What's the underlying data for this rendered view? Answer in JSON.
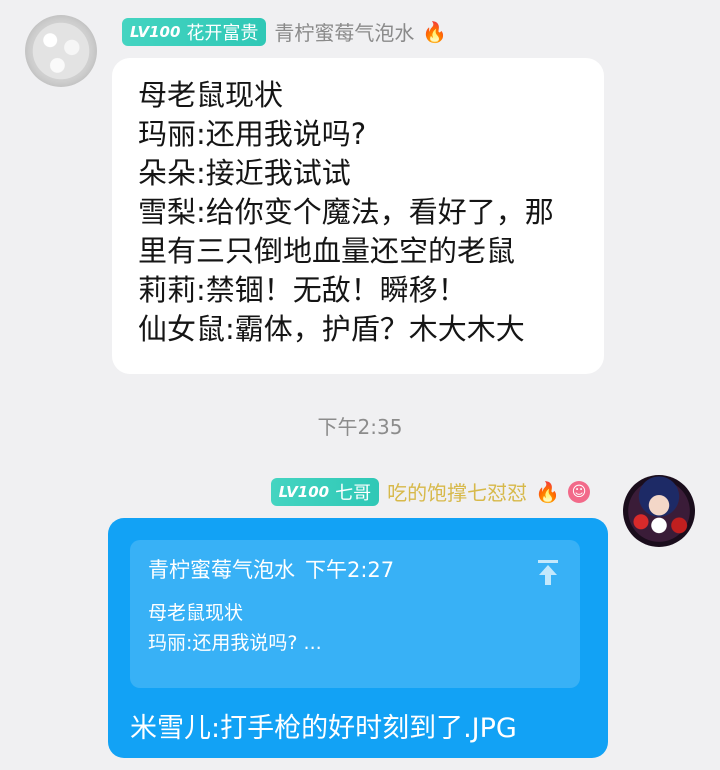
{
  "messages": [
    {
      "side": "left",
      "level": "LV100",
      "title": "花开富贵",
      "nickname": "青柠蜜莓气泡水",
      "icons": [
        "flame-icon"
      ],
      "lines": [
        "母老鼠现状",
        "玛丽:还用我说吗?",
        "朵朵:接近我试试",
        "雪梨:给你变个魔法，看好了，那",
        "里有三只倒地血量还空的老鼠",
        "莉莉:禁锢！无敌！瞬移！",
        "仙女鼠:霸体，护盾？木大木大"
      ]
    },
    {
      "side": "right",
      "level": "LV100",
      "title": "七哥",
      "nickname": "吃的饱撑七怼怼",
      "icons": [
        "flame-icon",
        "smile-emoji-icon"
      ],
      "quote": {
        "author": "青柠蜜莓气泡水",
        "time": "下午2:27",
        "lines": [
          "母老鼠现状",
          "玛丽:还用我说吗? ..."
        ]
      },
      "text": "米雪儿:打手枪的好时刻到了.JPG"
    }
  ],
  "timestamp": "下午2:35",
  "colors": {
    "background": "#f0f0f2",
    "badge": "#2fc8b6",
    "bubble_right": "#12a2f5",
    "nickname_right": "#d7b94a"
  }
}
